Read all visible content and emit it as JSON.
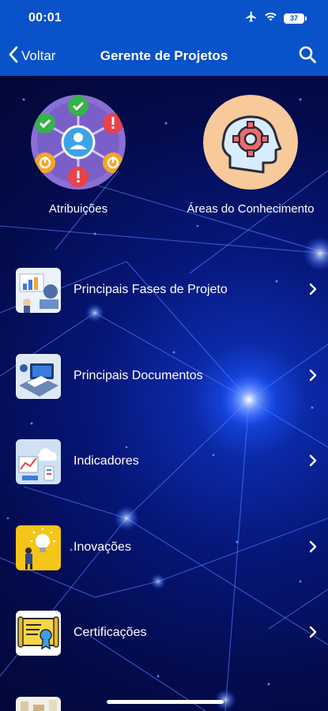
{
  "status_bar": {
    "time": "00:01",
    "battery": "37",
    "icons": [
      "airplane-icon",
      "wifi-icon",
      "battery-icon"
    ]
  },
  "nav": {
    "back_label": "Voltar",
    "title": "Gerente de Projetos",
    "search_icon": "search-icon"
  },
  "tiles": [
    {
      "label": "Atribuições",
      "icon": "people-network-icon"
    },
    {
      "label": "Áreas do Conhecimento",
      "icon": "head-gear-icon"
    }
  ],
  "menu_items": [
    {
      "label": "Principais Fases de Projeto",
      "icon": "project-phases-thumbnail"
    },
    {
      "label": "Principais Documentos",
      "icon": "documents-thumbnail"
    },
    {
      "label": "Indicadores",
      "icon": "indicators-thumbnail"
    },
    {
      "label": "Inovações",
      "icon": "innovations-thumbnail"
    },
    {
      "label": "Certificações",
      "icon": "certificate-thumbnail"
    }
  ],
  "colors": {
    "nav_blue": "#0a52c9",
    "background_deep": "#040b4c",
    "glow_blue": "#1e56ff"
  }
}
